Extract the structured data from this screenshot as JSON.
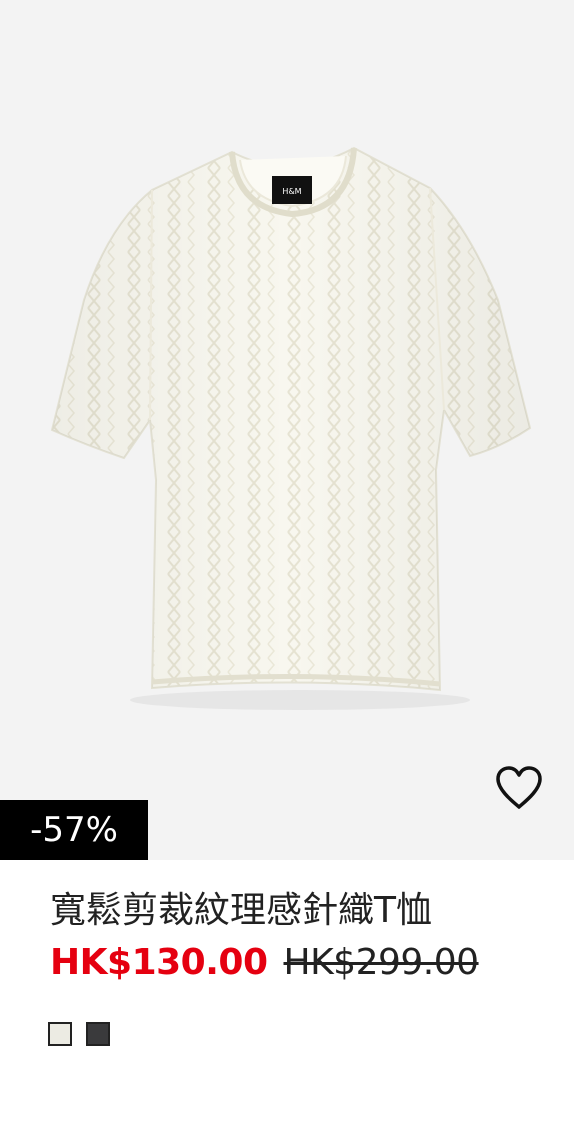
{
  "product": {
    "image_alt": "寬鬆剪裁紋理感針織T恤",
    "discount_label": "-57%",
    "title": "寬鬆剪裁紋理感針織T恤",
    "sale_price": "HK$130.00",
    "original_price": "HK$299.00",
    "favorite_icon": "heart-outline-icon",
    "swatches": [
      {
        "name": "cream",
        "color": "#ecebe3"
      },
      {
        "name": "dark-grey",
        "color": "#3a3a3c"
      }
    ]
  },
  "colors": {
    "sale": "#e50010",
    "badge_bg": "#000000",
    "image_bg": "#f3f3f3",
    "text": "#222222"
  }
}
